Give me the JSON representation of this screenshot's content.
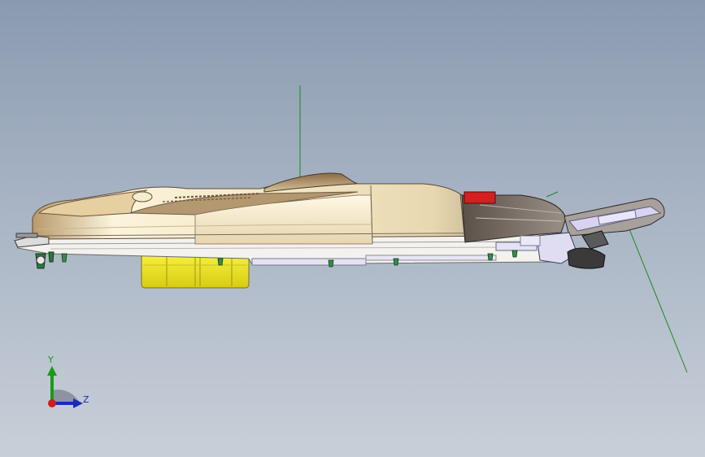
{
  "viewport": {
    "background_top": "#8a9ab0",
    "background_bottom": "#c8cfd8",
    "colors": {
      "shell_light": "#f3ecd8",
      "shell_mid": "#d8c49a",
      "shell_dark": "#8a6a48",
      "base_plate": "#f4f2ee",
      "lavender_parts": "#d8d4f0",
      "yellow_block": "#f0e820",
      "red_marker": "#d42020",
      "reference_line": "#1a8a1a"
    }
  },
  "triad": {
    "y_label": "Y",
    "z_label": "Z",
    "y_color": "#1a9a1a",
    "z_color": "#1a2ab8",
    "origin_color": "#d41a1a"
  }
}
